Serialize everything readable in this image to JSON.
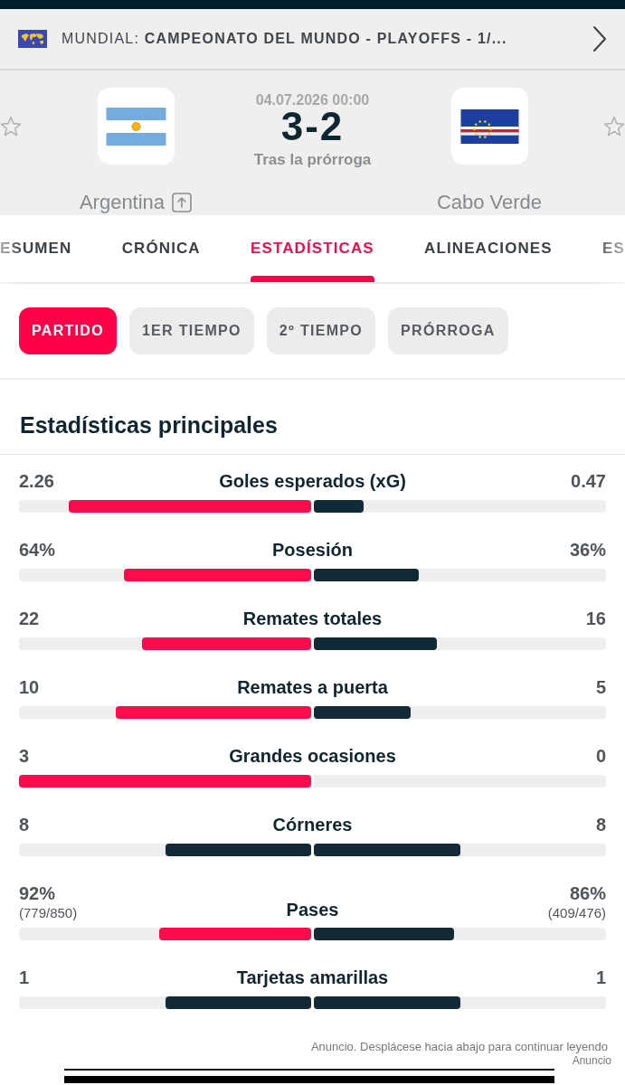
{
  "competition": {
    "title": "MUNDIAL: **CAMPEONATO DEL MUNDO - PLAYOFFS - 1/...**"
  },
  "match": {
    "date": "04.07.2026 00:00",
    "score": "3-2",
    "status": "Tras la prórroga"
  },
  "teams": [
    {
      "name": "Argentina",
      "advanced": true
    },
    {
      "name": "Cabo Verde",
      "advanced": false
    }
  ],
  "tabs": [
    {
      "label": "ESUMEN",
      "selected": false
    },
    {
      "label": "CRÓNICA",
      "selected": false
    },
    {
      "label": "ESTADÍSTICAS",
      "selected": true
    },
    {
      "label": "ALINEACIONES",
      "selected": false
    },
    {
      "label": "ES",
      "selected": false
    }
  ],
  "periods": [
    {
      "label": "PARTIDO",
      "selected": true
    },
    {
      "label": "1ER TIEMPO",
      "selected": false
    },
    {
      "label": "2º TIEMPO",
      "selected": false
    },
    {
      "label": "PRÓRROGA",
      "selected": false
    }
  ],
  "section_title": "Estadísticas principales",
  "stats": [
    {
      "label": "Goles esperados (xG)",
      "home": {
        "value": "2.26",
        "level": 0.83,
        "leading": true
      },
      "away": {
        "value": "0.47",
        "level": 0.17,
        "leading": false
      }
    },
    {
      "label": "Posesión",
      "home": {
        "value": "64%",
        "level": 0.64,
        "leading": true
      },
      "away": {
        "value": "36%",
        "level": 0.36,
        "leading": false
      }
    },
    {
      "label": "Remates totales",
      "home": {
        "value": "22",
        "level": 0.58,
        "leading": true
      },
      "away": {
        "value": "16",
        "level": 0.42,
        "leading": false
      }
    },
    {
      "label": "Remates a puerta",
      "home": {
        "value": "10",
        "level": 0.67,
        "leading": true
      },
      "away": {
        "value": "5",
        "level": 0.33,
        "leading": false
      }
    },
    {
      "label": "Grandes ocasiones",
      "home": {
        "value": "3",
        "level": 1,
        "leading": true
      },
      "away": {
        "value": "0"
      }
    },
    {
      "label": "Córneres",
      "home": {
        "value": "8",
        "level": 0.5,
        "leading": false
      },
      "away": {
        "value": "8",
        "level": 0.5,
        "leading": false
      }
    },
    {
      "label": "Pases",
      "home": {
        "value": "92%",
        "detail": "(779/850)",
        "level": 0.52,
        "leading": true
      },
      "away": {
        "value": "86%",
        "detail": "(409/476)",
        "level": 0.48,
        "leading": false
      }
    },
    {
      "label": "Tarjetas amarillas",
      "home": {
        "value": "1",
        "level": 0.5,
        "leading": false
      },
      "away": {
        "value": "1",
        "level": 0.5,
        "leading": false
      }
    }
  ],
  "ad": {
    "notice": "Anuncio. Desplácese hacia abajo para continuar leyendo",
    "label": "Anuncio"
  }
}
